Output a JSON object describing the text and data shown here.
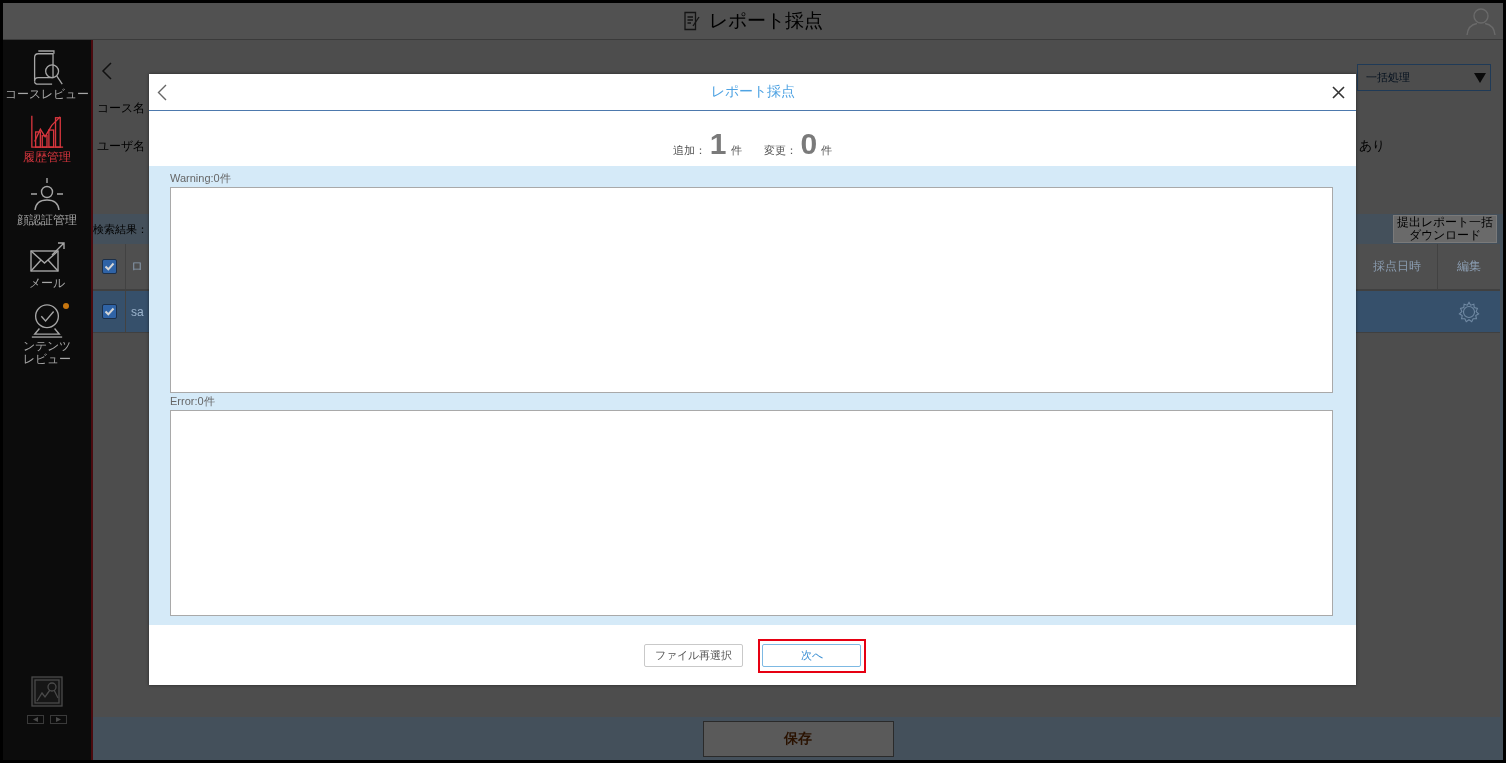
{
  "header": {
    "title": "レポート採点"
  },
  "sidebar": {
    "items": [
      {
        "kind": "book",
        "label": "コースレビュー",
        "selected": false,
        "notice": false
      },
      {
        "kind": "chart",
        "label": "履歴管理",
        "selected": true,
        "notice": false
      },
      {
        "kind": "face",
        "label": "顔認証管理",
        "selected": false,
        "notice": false
      },
      {
        "kind": "mail",
        "label": "メール",
        "selected": false,
        "notice": false
      },
      {
        "kind": "review",
        "label": "ンテンツレビュー",
        "selected": false,
        "notice": true
      }
    ]
  },
  "filters": {
    "course_label": "コース名",
    "user_label": "ユーザ名",
    "note": "あり",
    "bulk_action": {
      "value": "一括処理"
    }
  },
  "results": {
    "label": "検索結果：",
    "download_button": "提出レポート一括ダウンロード",
    "all_checked": true,
    "columns": [
      {
        "label": "ロ"
      },
      {
        "label": "採点日時"
      },
      {
        "label": "編集"
      }
    ],
    "rows": [
      {
        "selected": true,
        "checked": true,
        "cells": [
          "sa"
        ]
      }
    ]
  },
  "save_button": "保存",
  "dialog": {
    "title": "レポート採点",
    "counts": [
      {
        "label": "追加：",
        "value": "1",
        "unit": "件"
      },
      {
        "label": "変更：",
        "value": "0",
        "unit": "件"
      }
    ],
    "logs": [
      {
        "label": "Warning:0件"
      },
      {
        "label": "Error:0件"
      }
    ],
    "buttons": [
      {
        "kind": "secondary",
        "label": "ファイル再選択",
        "highlighted": false
      },
      {
        "kind": "primary",
        "label": "次へ",
        "highlighted": true
      }
    ]
  }
}
